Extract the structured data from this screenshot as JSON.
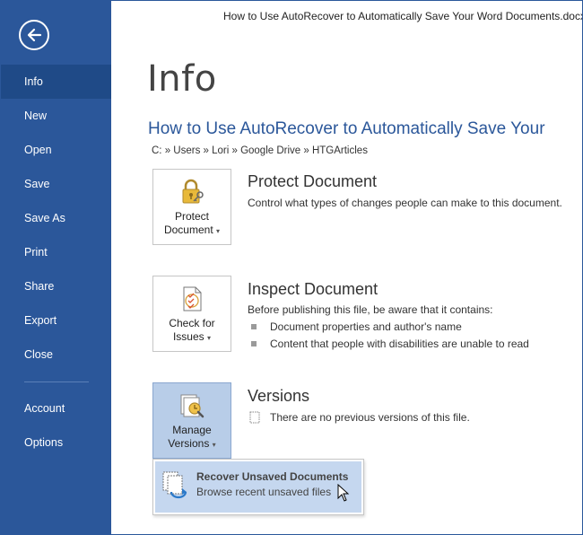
{
  "window": {
    "title": "How to Use AutoRecover to Automatically Save Your Word Documents.docx"
  },
  "sidebar": {
    "items": [
      {
        "label": "Info",
        "active": true
      },
      {
        "label": "New"
      },
      {
        "label": "Open"
      },
      {
        "label": "Save"
      },
      {
        "label": "Save As"
      },
      {
        "label": "Print"
      },
      {
        "label": "Share"
      },
      {
        "label": "Export"
      },
      {
        "label": "Close"
      },
      {
        "label": "Account"
      },
      {
        "label": "Options"
      }
    ]
  },
  "main": {
    "page_title": "Info",
    "doc_title": "How to Use AutoRecover to Automatically Save Your",
    "breadcrumb": "C: » Users » Lori » Google Drive » HTGArticles",
    "protect": {
      "button_line1": "Protect",
      "button_line2": "Document",
      "title": "Protect Document",
      "desc": "Control what types of changes people can make to this document."
    },
    "inspect": {
      "button_line1": "Check for",
      "button_line2": "Issues",
      "title": "Inspect Document",
      "desc": "Before publishing this file, be aware that it contains:",
      "bullets": [
        "Document properties and author's name",
        "Content that people with disabilities are unable to read"
      ]
    },
    "versions": {
      "button_line1": "Manage",
      "button_line2": "Versions",
      "title": "Versions",
      "desc": "There are no previous versions of this file."
    },
    "dropdown": {
      "title": "Recover Unsaved Documents",
      "subtitle": "Browse recent unsaved files"
    }
  },
  "colors": {
    "sidebar_bg": "#2b579a",
    "sidebar_active": "#1f4a87",
    "accent_text": "#2b579a",
    "hover_tile": "#b8cde8",
    "dropdown_hover": "#c5d7ef"
  }
}
